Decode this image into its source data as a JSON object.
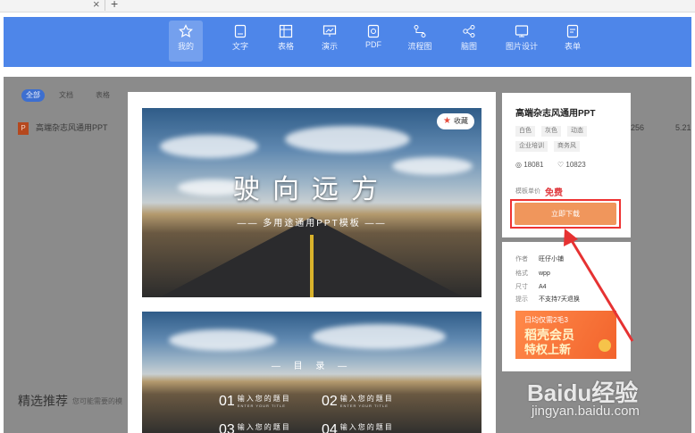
{
  "browser": {
    "close_glyph": "×",
    "new_tab_glyph": "+"
  },
  "toolbar": {
    "items": [
      {
        "label": "我的",
        "icon": "star-icon"
      },
      {
        "label": "文字",
        "icon": "document-icon"
      },
      {
        "label": "表格",
        "icon": "table-icon"
      },
      {
        "label": "演示",
        "icon": "presentation-icon"
      },
      {
        "label": "PDF",
        "icon": "pdf-icon"
      },
      {
        "label": "流程图",
        "icon": "flowchart-icon"
      },
      {
        "label": "脑图",
        "icon": "mindmap-icon"
      },
      {
        "label": "图片设计",
        "icon": "image-design-icon"
      },
      {
        "label": "表单",
        "icon": "form-icon"
      }
    ]
  },
  "background": {
    "filters": [
      "全部",
      "文档",
      "表格"
    ],
    "file_icon_letter": "P",
    "file_name": "高端杂志风通用PPT",
    "numbers": [
      "256",
      "5.21"
    ],
    "recommend_title": "精选推荐",
    "recommend_sub": "您可能需要的模"
  },
  "preview": {
    "collect_label": "收藏",
    "slide1_title": "驶向远方",
    "slide1_subtitle": "—— 多用途通用PPT模板 ——",
    "slide2_title": "— 目  录 —",
    "slide2_items": [
      {
        "num": "01",
        "text": "输入您的题目",
        "sub": "ENTER YOUR TITLE"
      },
      {
        "num": "02",
        "text": "输入您的题目",
        "sub": "ENTER YOUR TITLE"
      },
      {
        "num": "03",
        "text": "输入您的题目",
        "sub": ""
      },
      {
        "num": "04",
        "text": "输入您的题目",
        "sub": ""
      }
    ]
  },
  "info": {
    "title": "高端杂志风通用PPT",
    "tags": [
      "白色",
      "灰色",
      "动态",
      "企业培训",
      "商务风"
    ],
    "views": "18081",
    "likes": "10823",
    "price_label": "模板单价",
    "price_value": "免费",
    "download_label": "立即下载"
  },
  "meta": {
    "rows": [
      {
        "key": "作者",
        "value": "旺仔小铺"
      },
      {
        "key": "格式",
        "value": "wpp"
      },
      {
        "key": "尺寸",
        "value": "A4"
      },
      {
        "key": "提示",
        "value": "不支持7天退换"
      }
    ],
    "ad_line1": "日均仅需2毛3",
    "ad_line2": "稻壳会员",
    "ad_line3": "特权上新"
  },
  "watermark": {
    "main": "Baidu经验",
    "sub": "jingyan.baidu.com"
  },
  "colors": {
    "toolbar": "#4e86e9",
    "download": "#f0965c",
    "highlight": "#e33333",
    "price": "#e0393e"
  }
}
